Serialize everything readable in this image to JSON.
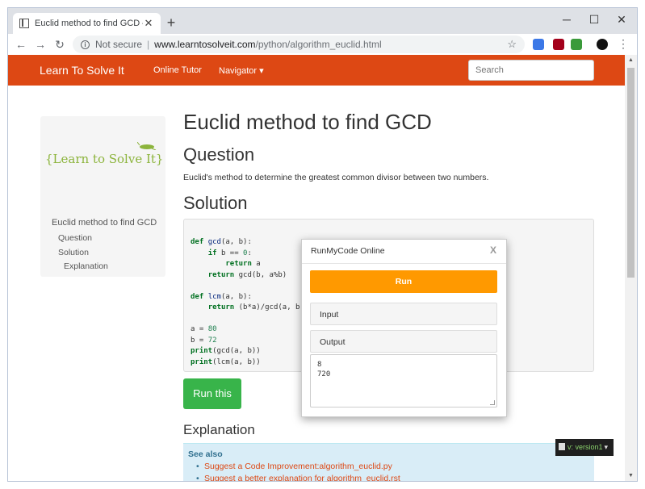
{
  "browser": {
    "tab_title": "Euclid method to find GCD — Le",
    "tab_close": "✕",
    "new_tab": "+",
    "window_controls": {
      "minimize": "─",
      "maximize": "☐",
      "close": "✕"
    },
    "nav": {
      "back": "←",
      "forward": "→",
      "reload": "↻"
    },
    "security_label": "Not secure",
    "separator": "|",
    "url_host": "www.learntosolveit.com",
    "url_path": "/python/algorithm_euclid.html",
    "star": "☆",
    "menu": "⋮"
  },
  "navbar": {
    "brand": "Learn To Solve It",
    "online_tutor": "Online Tutor",
    "navigator": "Navigator ▾",
    "search_placeholder": "Search"
  },
  "sidebar": {
    "logo_text": "{Learn to Solve It}",
    "toc": {
      "top": "Euclid method to find GCD",
      "question": "Question",
      "solution": "Solution",
      "explanation": "Explanation"
    }
  },
  "main": {
    "title": "Euclid method to find GCD",
    "question_heading": "Question",
    "question_text": "Euclid's method to determine the greatest common divisor between two numbers.",
    "solution_heading": "Solution",
    "run_this": "Run this",
    "explanation_heading": "Explanation",
    "see_also": {
      "title": "See also",
      "links": [
        "Suggest a Code Improvement:algorithm_euclid.py",
        "Suggest a better explanation for algorithm_euclid.rst"
      ]
    }
  },
  "modal": {
    "title": "RunMyCode Online",
    "close": "X",
    "run": "Run",
    "input_label": "Input",
    "output_label": "Output",
    "output_text": "8\n720"
  },
  "version_badge": {
    "label": "v: version1",
    "caret": "▾"
  },
  "colors": {
    "navbar": "#dd4814",
    "run_this": "#38b44a",
    "modal_run": "#ff9900",
    "see_also_bg": "#d9edf7"
  }
}
